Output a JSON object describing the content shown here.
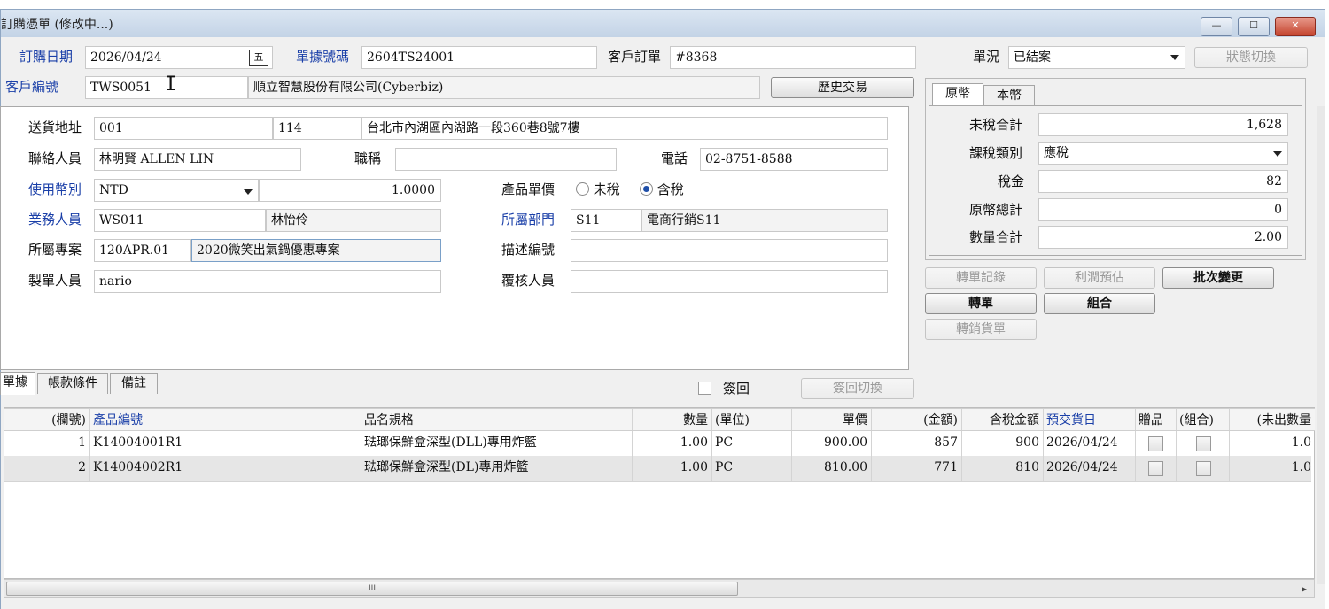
{
  "window": {
    "title": "訂購憑單 (修改中...)",
    "minimize_glyph": "—",
    "maximize_glyph": "☐",
    "close_glyph": "✕"
  },
  "header": {
    "order_date_label": "訂購日期",
    "order_date_value": "2026/04/24",
    "calendar_glyph": "五",
    "doc_no_label": "單據號碼",
    "doc_no_value": "2604TS24001",
    "customer_order_label": "客戶訂單",
    "customer_order_value": "#8368",
    "status_label": "單況",
    "status_value": "已結案",
    "status_switch_label": "狀態切換",
    "customer_no_label": "客戶編號",
    "customer_no_value": "TWS0051",
    "customer_name_value": "順立智慧股份有限公司(Cyberbiz)",
    "history_button": "歷史交易"
  },
  "detail": {
    "ship_addr_label": "送貨地址",
    "ship_addr_code": "001",
    "ship_zip": "114",
    "ship_addr_text": "台北市內湖區內湖路一段360巷8號7樓",
    "contact_label": "聯絡人員",
    "contact_value": "林明賢 ALLEN LIN",
    "title_label": "職稱",
    "title_value": "",
    "phone_label": "電話",
    "phone_value": "02-8751-8588",
    "currency_label": "使用幣別",
    "currency_value": "NTD",
    "rate_value": "1.0000",
    "price_label": "產品單價",
    "price_untaxed": "未稅",
    "price_taxed": "含稅",
    "sales_label": "業務人員",
    "sales_code": "WS011",
    "sales_name": "林怡伶",
    "dept_label": "所屬部門",
    "dept_code": "S11",
    "dept_name": "電商行銷S11",
    "project_label": "所屬專案",
    "project_code": "120APR.01",
    "project_name": "2020微笑出氣鍋優惠專案",
    "desc_label": "描述編號",
    "desc_value": "",
    "maker_label": "製單人員",
    "maker_value": "nario",
    "reviewer_label": "覆核人員",
    "reviewer_value": ""
  },
  "totals": {
    "tab_original": "原幣",
    "tab_local": "本幣",
    "pretax_label": "未稅合計",
    "pretax_value": "1,628",
    "taxtype_label": "課稅類別",
    "taxtype_value": "應稅",
    "tax_label": "稅金",
    "tax_value": "82",
    "total_label": "原幣總計",
    "total_value": "0",
    "qty_label": "數量合計",
    "qty_value": "2.00"
  },
  "actions": {
    "transfer_record": "轉單記錄",
    "profit_estimate": "利潤預估",
    "batch_change": "批次變更",
    "transfer": "轉單",
    "combine": "組合",
    "transfer_sales": "轉銷貨單"
  },
  "lower_tabs": {
    "tab1": "單據",
    "tab2": "帳款條件",
    "tab3": "備註",
    "signback_label": "簽回",
    "signback_switch": "簽回切換"
  },
  "grid": {
    "columns": [
      "(欄號)",
      "產品編號",
      "品名規格",
      "數量",
      "(單位)",
      "單價",
      "(金額)",
      "含稅金額",
      "預交貨日",
      "贈品",
      "(組合)",
      "(未出數量"
    ],
    "rows": [
      {
        "no": "1",
        "code": "K14004001R1",
        "name": "琺瑯保鮮盒深型(DLL)專用炸籃",
        "qty": "1.00",
        "unit": "PC",
        "price": "900.00",
        "amount": "857",
        "taxed": "900",
        "date": "2026/04/24",
        "remain": "1.0"
      },
      {
        "no": "2",
        "code": "K14004002R1",
        "name": "琺瑯保鮮盒深型(DL)專用炸籃",
        "qty": "1.00",
        "unit": "PC",
        "price": "810.00",
        "amount": "771",
        "taxed": "810",
        "date": "2026/04/24",
        "remain": "1.0"
      }
    ]
  },
  "scrollbar": {
    "grip": "III",
    "right_arrow": "▸"
  }
}
